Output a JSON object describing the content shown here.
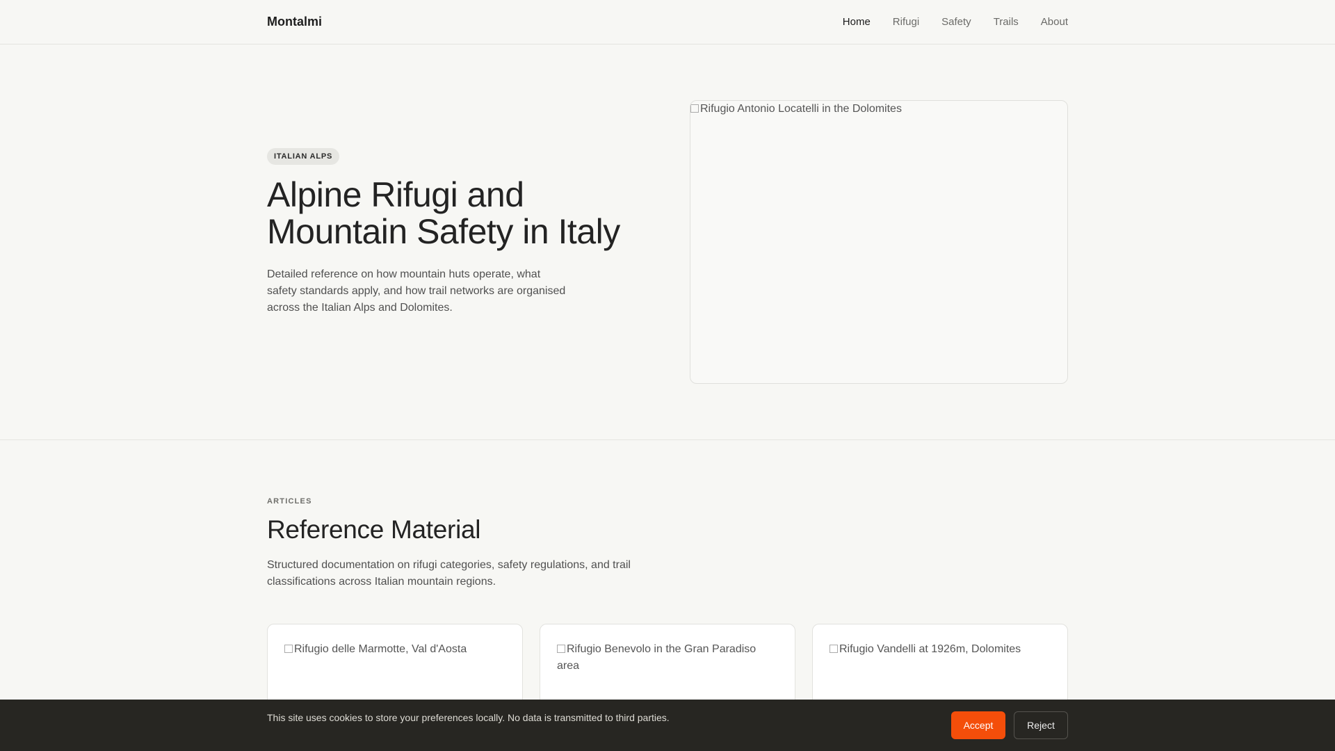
{
  "header": {
    "brand": "Montalmi",
    "nav": [
      {
        "label": "Home",
        "active": true
      },
      {
        "label": "Rifugi",
        "active": false
      },
      {
        "label": "Safety",
        "active": false
      },
      {
        "label": "Trails",
        "active": false
      },
      {
        "label": "About",
        "active": false
      }
    ]
  },
  "hero": {
    "badge": "ITALIAN ALPS",
    "title": "Alpine Rifugi and Mountain Safety in Italy",
    "description": "Detailed reference on how mountain huts operate, what safety standards apply, and how trail networks are organised across the Italian Alps and Dolomites.",
    "image_alt": "Rifugio Antonio Locatelli in the Dolomites"
  },
  "articles": {
    "eyebrow": "ARTICLES",
    "title": "Reference Material",
    "description": "Structured documentation on rifugi categories, safety regulations, and trail classifications across Italian mountain regions.",
    "cards": [
      {
        "image_alt": "Rifugio delle Marmotte, Val d'Aosta"
      },
      {
        "image_alt": "Rifugio Benevolo in the Gran Paradiso area"
      },
      {
        "image_alt": "Rifugio Vandelli at 1926m, Dolomites"
      }
    ]
  },
  "cookie_banner": {
    "text": "This site uses cookies to store your preferences locally. No data is transmitted to third parties.",
    "accept_label": "Accept",
    "reject_label": "Reject",
    "accent_color": "#f44e0a"
  }
}
